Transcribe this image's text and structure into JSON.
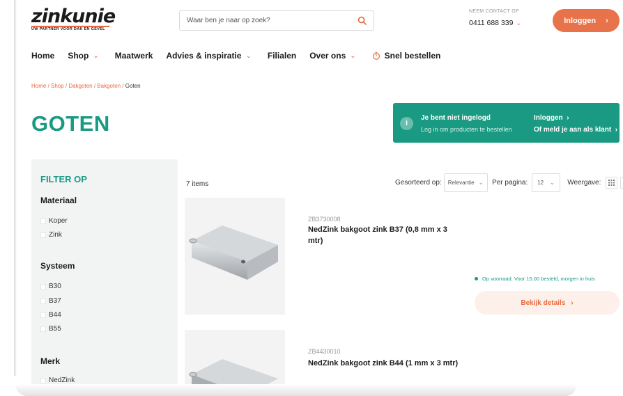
{
  "header": {
    "logo_text": "zinkunie",
    "logo_tagline": "UW PARTNER VOOR DAK EN GEVEL",
    "search_placeholder": "Waar ben je naar op zoek?",
    "contact_label": "NEEM CONTACT OP",
    "contact_phone": "0411 688 339",
    "login_label": "Inloggen"
  },
  "nav": {
    "items": [
      {
        "label": "Home",
        "has_dropdown": false
      },
      {
        "label": "Shop",
        "has_dropdown": true
      },
      {
        "label": "Maatwerk",
        "has_dropdown": false
      },
      {
        "label": "Advies & inspiratie",
        "has_dropdown": true
      },
      {
        "label": "Filialen",
        "has_dropdown": false
      },
      {
        "label": "Over ons",
        "has_dropdown": true
      },
      {
        "label": "Snel bestellen",
        "has_dropdown": false,
        "icon": "timer-icon"
      }
    ]
  },
  "breadcrumb": {
    "items": [
      "Home",
      "Shop",
      "Dakgoten",
      "Bakgoten"
    ],
    "current": "Goten"
  },
  "page": {
    "title": "GOTEN"
  },
  "notice": {
    "title": "Je bent niet ingelogd",
    "subtitle": "Log in om producten te bestellen",
    "login_link": "Inloggen",
    "register_link": "Of meld je aan als klant"
  },
  "filter": {
    "title": "FILTER OP",
    "groups": [
      {
        "name": "Materiaal",
        "options": [
          "Koper",
          "Zink"
        ]
      },
      {
        "name": "Systeem",
        "options": [
          "B30",
          "B37",
          "B44",
          "B55"
        ]
      },
      {
        "name": "Merk",
        "options": [
          "NedZink"
        ]
      }
    ]
  },
  "toolbar": {
    "items_count": "7 items",
    "sort_label": "Gesorteerd op:",
    "sort_value": "Relevantie",
    "per_page_label": "Per pagina:",
    "per_page_value": "12",
    "view_label": "Weergave:",
    "active_view": "list"
  },
  "products": [
    {
      "sku": "ZB3730008",
      "name": "NedZink bakgoot zink B37 (0,8 mm x 3 mtr)",
      "stock": "Op voorraad. Voor 15.00 besteld, morgen in huis",
      "details_label": "Bekijk details"
    },
    {
      "sku": "ZB4430010",
      "name": "NedZink bakgoot zink B44 (1 mm x 3 mtr)"
    }
  ],
  "colors": {
    "accent": "#e86a3e",
    "brand_green": "#1a9a82",
    "filter_bg": "#f2f4f3"
  }
}
